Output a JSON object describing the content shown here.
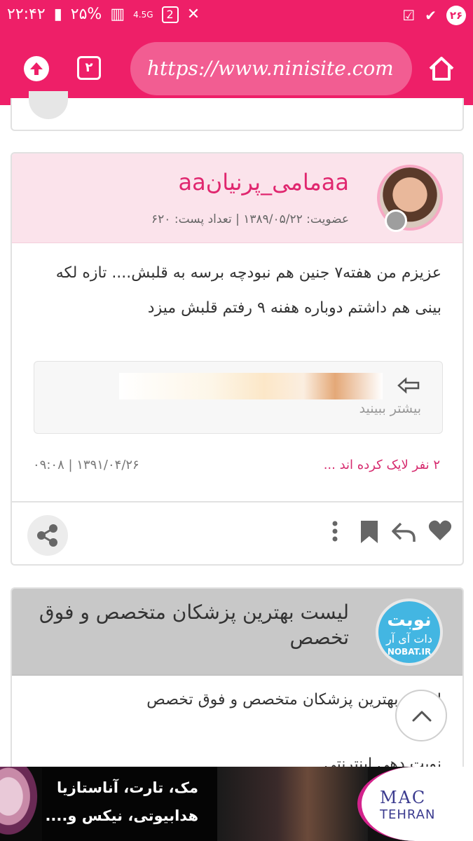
{
  "status_bar": {
    "time": "۲۲:۴۲",
    "battery": "۲۵%",
    "network": "4.5G",
    "sim": "2",
    "notification_count": "۲۶"
  },
  "browser": {
    "tab_count": "۲",
    "url": "https://www.ninisite.com"
  },
  "post": {
    "username": "aaمامی_پرنیانaa",
    "member_info": "عضویت: ۱۳۸۹/۰۵/۲۲ | تعداد پست: ۶۲۰",
    "body": "عزیزم من هفته۷ جنین هم نبودچه برسه به قلبش.... تازه لکه بینی هم داشتم دوباره هفنه ۹ رفتم قلبش میزد",
    "preview_more": "بیشتر ببینید",
    "likes": "۲ نفر لایک کرده اند ...",
    "date": "۰۹:۰۸ | ۱۳۹۱/۰۴/۲۶"
  },
  "ad": {
    "avatar_line1": "نوبت",
    "avatar_line2": "دات آی آر",
    "avatar_line3": "NOBAT.IR",
    "title": "لیست بهترین پزشکان متخصص و فوق تخصص",
    "body": "لیست بهترین پزشکان متخصص و فوق تخصص",
    "more": "نوبت دهی اینترنتی..."
  },
  "banner": {
    "line1": "مک، تارت، آناستازیا",
    "line2": "هدابیوتی، نیکس و....",
    "logo": "MAC",
    "logo_sub": "TEHRAN"
  }
}
